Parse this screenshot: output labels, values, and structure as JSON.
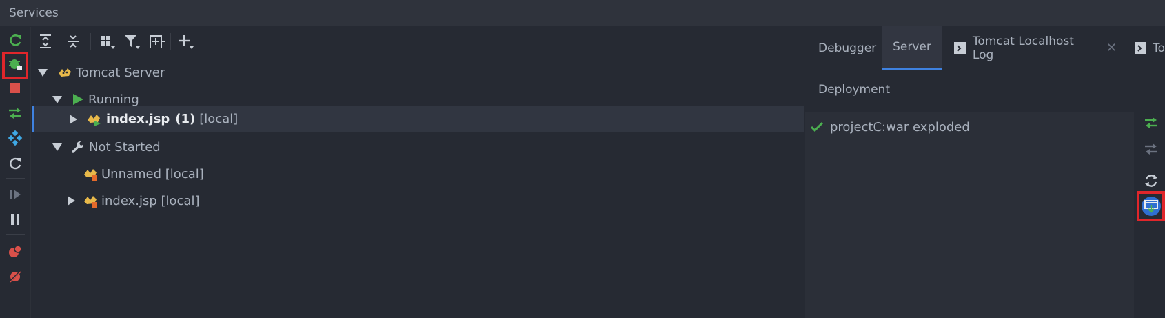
{
  "window": {
    "title": "Services"
  },
  "left_toolbar": {
    "icons": [
      "refresh-green-icon",
      "debug-bug-icon",
      "stop-icon",
      "deploy-icon",
      "services-diamond-icon",
      "rerun-icon",
      "resume-icon",
      "pause-icon",
      "breakpoints-icon",
      "mute-breakpoints-icon"
    ]
  },
  "top_toolbar": {
    "icons": [
      "expand-all-icon",
      "collapse-all-icon",
      "group-by-icon",
      "filter-icon",
      "add-service-icon",
      "plus-icon"
    ]
  },
  "tree": {
    "root": {
      "label": "Tomcat Server"
    },
    "running": {
      "label": "Running"
    },
    "running_item": {
      "name": "index.jsp",
      "count": "(1)",
      "suffix": "[local]"
    },
    "not_started": {
      "label": "Not Started"
    },
    "ns_item1": {
      "label": "Unnamed [local]"
    },
    "ns_item2": {
      "label": "index.jsp [local]"
    }
  },
  "tabs": [
    {
      "label": "Debugger"
    },
    {
      "label": "Server",
      "active": true
    },
    {
      "label": "Tomcat Localhost Log",
      "closable": true
    },
    {
      "label": "To"
    }
  ],
  "deployment": {
    "label": "Deployment",
    "items": [
      {
        "label": "projectC:war exploded",
        "status": "ok"
      }
    ]
  },
  "right_toolbar": {
    "icons": [
      "deploy-all-icon",
      "undeploy-icon",
      "refresh-icon",
      "update-resources-icon"
    ]
  },
  "colors": {
    "accent": "#3f82e0",
    "highlight": "#e0262b",
    "green": "#4caf50",
    "red": "#d9504a"
  }
}
